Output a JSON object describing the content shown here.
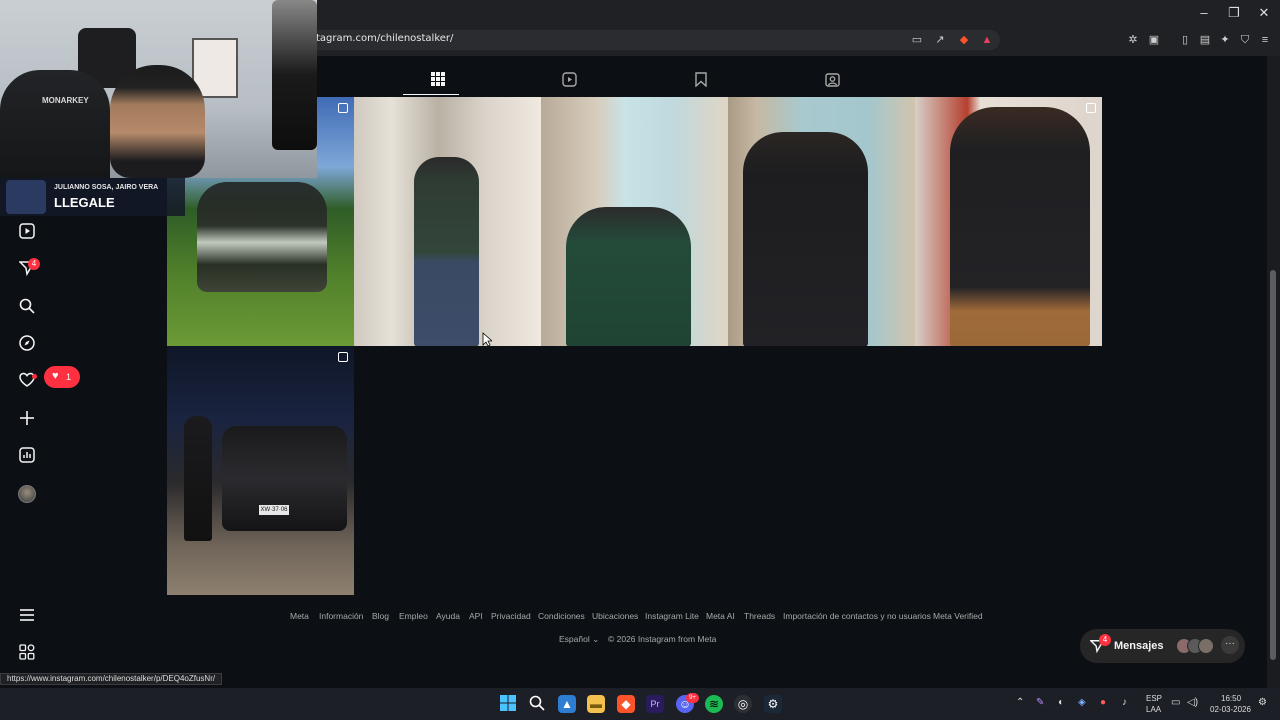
{
  "browser": {
    "url": "tagram.com/chilenostalker/",
    "status_url": "https://www.instagram.com/chilenostalker/p/DEQ4oZfusNr/"
  },
  "overlay": {
    "names": "JULIANNO SOSA, JAIRO VERA",
    "message": "LLEGALE"
  },
  "webcam": {
    "chair_brand": "MONARKEY"
  },
  "sidebar": {
    "notifications_badge": "4",
    "likes_count": "1"
  },
  "tabs": [
    {
      "icon": "grid-icon",
      "active": true
    },
    {
      "icon": "reels-icon",
      "active": false
    },
    {
      "icon": "saved-icon",
      "active": false
    },
    {
      "icon": "tagged-icon",
      "active": false
    }
  ],
  "posts": [
    {
      "desc": "group-photo"
    },
    {
      "desc": "mirror-selfie-1"
    },
    {
      "desc": "mirror-selfie-2"
    },
    {
      "desc": "mirror-selfie-3"
    },
    {
      "desc": "mirror-selfie-4"
    },
    {
      "desc": "car-photo",
      "plate": "XW·37·06"
    }
  ],
  "footer": {
    "links": [
      "Meta",
      "Información",
      "Blog",
      "Empleo",
      "Ayuda",
      "API",
      "Privacidad",
      "Condiciones",
      "Ubicaciones",
      "Instagram Lite",
      "Meta AI",
      "Threads",
      "Importación de contactos y no usuarios",
      "Meta Verified"
    ],
    "language": "Español",
    "copyright": "© 2026 Instagram from Meta"
  },
  "messages": {
    "label": "Mensajes",
    "badge": "4"
  },
  "taskbar": {
    "lang_top": "ESP",
    "lang_bottom": "LAA",
    "time": "16:50",
    "date": "02-03-2026",
    "discord_badge": "9+"
  },
  "colors": {
    "background": "#0c1014",
    "badge_red": "#ff3040",
    "footer_text": "#a8a8a8"
  }
}
